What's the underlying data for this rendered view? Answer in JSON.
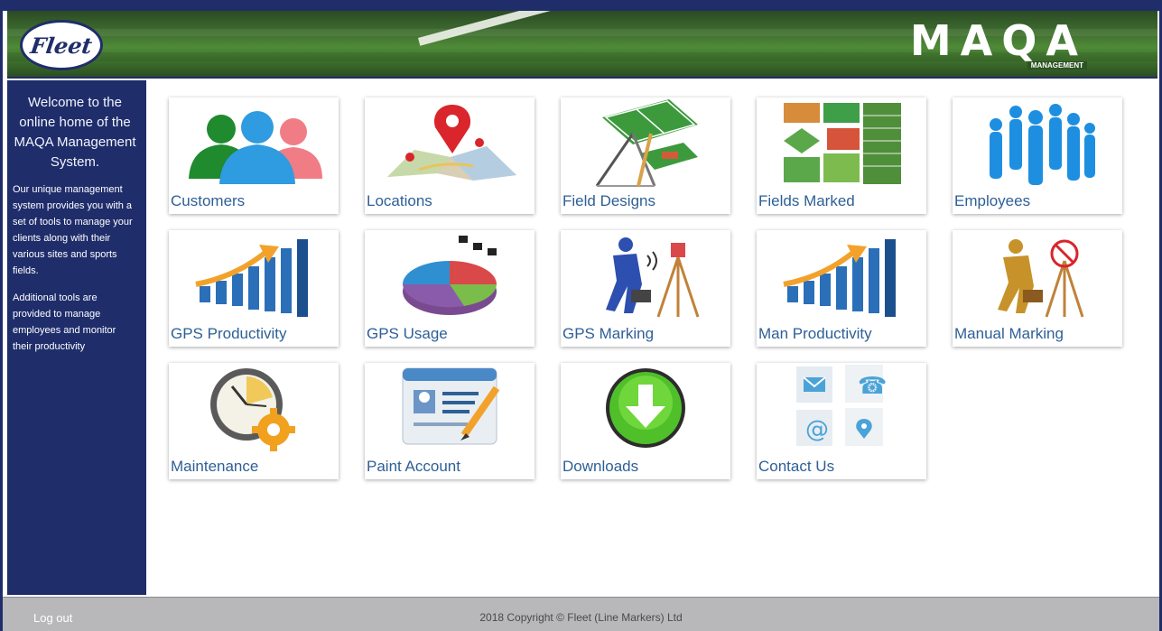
{
  "header": {
    "fleet_logo_text": "Fleet",
    "maqa_logo_text": "MAQA",
    "maqa_sub_text": "MANAGEMENT"
  },
  "sidebar": {
    "welcome": "Welcome to the online home of the MAQA Management System.",
    "description": "Our unique management system provides you with a set of tools to manage your clients along with their various sites and sports fields.",
    "description2": "Additional tools are provided to manage employees and monitor their productivity"
  },
  "tiles": [
    {
      "label": "Customers",
      "icon": "customers-icon"
    },
    {
      "label": "Locations",
      "icon": "map-pin-icon"
    },
    {
      "label": "Field Designs",
      "icon": "field-design-icon"
    },
    {
      "label": "Fields Marked",
      "icon": "fields-marked-icon"
    },
    {
      "label": "Employees",
      "icon": "employees-icon"
    },
    {
      "label": "GPS Productivity",
      "icon": "bar-chart-icon"
    },
    {
      "label": "GPS Usage",
      "icon": "pie-chart-icon"
    },
    {
      "label": "GPS Marking",
      "icon": "gps-surveyor-icon"
    },
    {
      "label": "Man Productivity",
      "icon": "bar-chart-icon"
    },
    {
      "label": "Manual Marking",
      "icon": "manual-surveyor-icon"
    },
    {
      "label": "Maintenance",
      "icon": "clock-gear-icon"
    },
    {
      "label": "Paint Account",
      "icon": "id-card-icon"
    },
    {
      "label": "Downloads",
      "icon": "download-icon"
    },
    {
      "label": "Contact Us",
      "icon": "contact-icon"
    }
  ],
  "footer": {
    "logout": "Log out",
    "copyright": "2018 Copyright © Fleet (Line Markers) Ltd"
  },
  "colors": {
    "navy": "#1f2d6b",
    "label_blue": "#2e5f96",
    "footer_gray": "#b8b8ba"
  }
}
